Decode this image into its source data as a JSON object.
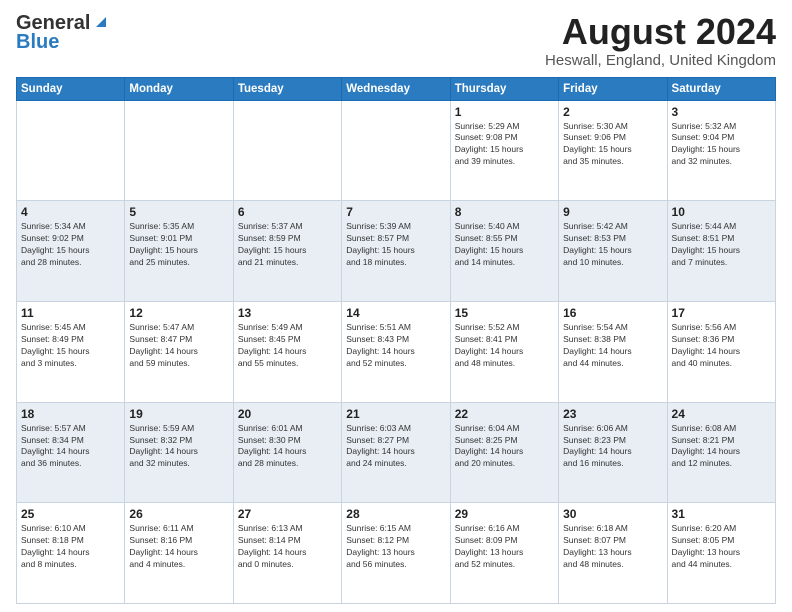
{
  "header": {
    "logo_line1": "General",
    "logo_line2": "Blue",
    "month_title": "August 2024",
    "location": "Heswall, England, United Kingdom"
  },
  "days_of_week": [
    "Sunday",
    "Monday",
    "Tuesday",
    "Wednesday",
    "Thursday",
    "Friday",
    "Saturday"
  ],
  "weeks": [
    [
      {
        "day": "",
        "info": ""
      },
      {
        "day": "",
        "info": ""
      },
      {
        "day": "",
        "info": ""
      },
      {
        "day": "",
        "info": ""
      },
      {
        "day": "1",
        "info": "Sunrise: 5:29 AM\nSunset: 9:08 PM\nDaylight: 15 hours\nand 39 minutes."
      },
      {
        "day": "2",
        "info": "Sunrise: 5:30 AM\nSunset: 9:06 PM\nDaylight: 15 hours\nand 35 minutes."
      },
      {
        "day": "3",
        "info": "Sunrise: 5:32 AM\nSunset: 9:04 PM\nDaylight: 15 hours\nand 32 minutes."
      }
    ],
    [
      {
        "day": "4",
        "info": "Sunrise: 5:34 AM\nSunset: 9:02 PM\nDaylight: 15 hours\nand 28 minutes."
      },
      {
        "day": "5",
        "info": "Sunrise: 5:35 AM\nSunset: 9:01 PM\nDaylight: 15 hours\nand 25 minutes."
      },
      {
        "day": "6",
        "info": "Sunrise: 5:37 AM\nSunset: 8:59 PM\nDaylight: 15 hours\nand 21 minutes."
      },
      {
        "day": "7",
        "info": "Sunrise: 5:39 AM\nSunset: 8:57 PM\nDaylight: 15 hours\nand 18 minutes."
      },
      {
        "day": "8",
        "info": "Sunrise: 5:40 AM\nSunset: 8:55 PM\nDaylight: 15 hours\nand 14 minutes."
      },
      {
        "day": "9",
        "info": "Sunrise: 5:42 AM\nSunset: 8:53 PM\nDaylight: 15 hours\nand 10 minutes."
      },
      {
        "day": "10",
        "info": "Sunrise: 5:44 AM\nSunset: 8:51 PM\nDaylight: 15 hours\nand 7 minutes."
      }
    ],
    [
      {
        "day": "11",
        "info": "Sunrise: 5:45 AM\nSunset: 8:49 PM\nDaylight: 15 hours\nand 3 minutes."
      },
      {
        "day": "12",
        "info": "Sunrise: 5:47 AM\nSunset: 8:47 PM\nDaylight: 14 hours\nand 59 minutes."
      },
      {
        "day": "13",
        "info": "Sunrise: 5:49 AM\nSunset: 8:45 PM\nDaylight: 14 hours\nand 55 minutes."
      },
      {
        "day": "14",
        "info": "Sunrise: 5:51 AM\nSunset: 8:43 PM\nDaylight: 14 hours\nand 52 minutes."
      },
      {
        "day": "15",
        "info": "Sunrise: 5:52 AM\nSunset: 8:41 PM\nDaylight: 14 hours\nand 48 minutes."
      },
      {
        "day": "16",
        "info": "Sunrise: 5:54 AM\nSunset: 8:38 PM\nDaylight: 14 hours\nand 44 minutes."
      },
      {
        "day": "17",
        "info": "Sunrise: 5:56 AM\nSunset: 8:36 PM\nDaylight: 14 hours\nand 40 minutes."
      }
    ],
    [
      {
        "day": "18",
        "info": "Sunrise: 5:57 AM\nSunset: 8:34 PM\nDaylight: 14 hours\nand 36 minutes."
      },
      {
        "day": "19",
        "info": "Sunrise: 5:59 AM\nSunset: 8:32 PM\nDaylight: 14 hours\nand 32 minutes."
      },
      {
        "day": "20",
        "info": "Sunrise: 6:01 AM\nSunset: 8:30 PM\nDaylight: 14 hours\nand 28 minutes."
      },
      {
        "day": "21",
        "info": "Sunrise: 6:03 AM\nSunset: 8:27 PM\nDaylight: 14 hours\nand 24 minutes."
      },
      {
        "day": "22",
        "info": "Sunrise: 6:04 AM\nSunset: 8:25 PM\nDaylight: 14 hours\nand 20 minutes."
      },
      {
        "day": "23",
        "info": "Sunrise: 6:06 AM\nSunset: 8:23 PM\nDaylight: 14 hours\nand 16 minutes."
      },
      {
        "day": "24",
        "info": "Sunrise: 6:08 AM\nSunset: 8:21 PM\nDaylight: 14 hours\nand 12 minutes."
      }
    ],
    [
      {
        "day": "25",
        "info": "Sunrise: 6:10 AM\nSunset: 8:18 PM\nDaylight: 14 hours\nand 8 minutes."
      },
      {
        "day": "26",
        "info": "Sunrise: 6:11 AM\nSunset: 8:16 PM\nDaylight: 14 hours\nand 4 minutes."
      },
      {
        "day": "27",
        "info": "Sunrise: 6:13 AM\nSunset: 8:14 PM\nDaylight: 14 hours\nand 0 minutes."
      },
      {
        "day": "28",
        "info": "Sunrise: 6:15 AM\nSunset: 8:12 PM\nDaylight: 13 hours\nand 56 minutes."
      },
      {
        "day": "29",
        "info": "Sunrise: 6:16 AM\nSunset: 8:09 PM\nDaylight: 13 hours\nand 52 minutes."
      },
      {
        "day": "30",
        "info": "Sunrise: 6:18 AM\nSunset: 8:07 PM\nDaylight: 13 hours\nand 48 minutes."
      },
      {
        "day": "31",
        "info": "Sunrise: 6:20 AM\nSunset: 8:05 PM\nDaylight: 13 hours\nand 44 minutes."
      }
    ]
  ]
}
